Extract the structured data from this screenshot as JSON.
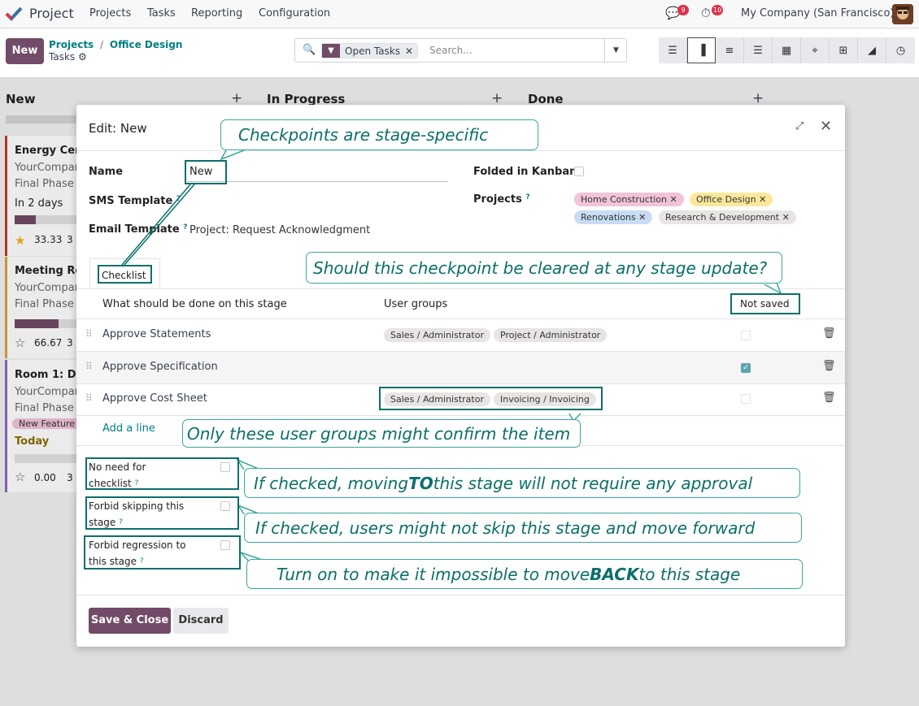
{
  "nav": {
    "app": "Project",
    "menus": [
      "Projects",
      "Tasks",
      "Reporting",
      "Configuration"
    ],
    "chat_count": "9",
    "activity_count": "10",
    "company": "My Company (San Francisco)"
  },
  "control": {
    "new_label": "New",
    "breadcrumb_root": "Projects",
    "breadcrumb_sep": "/",
    "breadcrumb_project": "Office Design",
    "breadcrumb_current": "Tasks",
    "facet": "Open Tasks",
    "search_placeholder": "Search..."
  },
  "kanban": {
    "columns": [
      "New",
      "In Progress",
      "Done"
    ],
    "cards": [
      {
        "title": "Energy Cer",
        "customer": "YourCompan",
        "stage": "Final Phase",
        "deadline": "In 2 days",
        "rating": "33.33",
        "count": "3",
        "progress": 0.33
      },
      {
        "title": "Meeting Ro",
        "customer": "YourCompan",
        "stage": "Final Phase",
        "rating": "66.67",
        "count": "3",
        "progress": 0.67
      },
      {
        "title": "Room 1: De",
        "customer": "YourCompan",
        "stage": "Final Phase",
        "tag": "New Feature",
        "deadline": "Today",
        "rating": "0.00",
        "count": "3",
        "progress": 0
      }
    ]
  },
  "modal": {
    "title": "Edit: New",
    "name_label": "Name",
    "name_value": "New",
    "sms_label": "SMS Template",
    "email_label": "Email Template",
    "email_value": "Project: Request Acknowledgment",
    "folded_label": "Folded in Kanban",
    "projects_label": "Projects",
    "projects": [
      {
        "name": "Home Construction",
        "color": "#f2c3d9"
      },
      {
        "name": "Office Design",
        "color": "#fbe89c"
      },
      {
        "name": "Renovations",
        "color": "#c8dcf5"
      },
      {
        "name": "Research & Development",
        "color": "#e9e4e4"
      }
    ],
    "tab": "Checklist",
    "col_task": "What should be done on this stage",
    "col_groups": "User groups",
    "col_saved": "Not saved",
    "rows": [
      {
        "task": "Approve Statements",
        "groups": [
          "Sales / Administrator",
          "Project / Administrator"
        ],
        "checked": false
      },
      {
        "task": "Approve Specification",
        "groups": [],
        "checked": true
      },
      {
        "task": "Approve Cost Sheet",
        "groups": [
          "Sales / Administrator",
          "Invoicing / Invoicing"
        ],
        "checked": false
      }
    ],
    "add_line": "Add a line",
    "no_need_1": "No need for",
    "no_need_2": "checklist",
    "forbid_skip_1": "Forbid skipping this",
    "forbid_skip_2": "stage",
    "forbid_reg_1": "Forbid regression to",
    "forbid_reg_2": "this stage",
    "save": "Save & Close",
    "discard": "Discard"
  },
  "callouts": {
    "stage_specific": "Checkpoints are stage-specific",
    "cleared": "Should this checkpoint be cleared at any stage update?",
    "groups": "Only these user groups might confirm the item",
    "no_need_a": "If checked, moving ",
    "no_need_b": "TO",
    "no_need_c": " this stage will not require any approval",
    "skip": "If checked, users might not skip this stage and move forward",
    "back_a": "Turn on to make it impossible to move ",
    "back_b": "BACK",
    "back_c": " to this stage"
  },
  "colors": {
    "accent": "#714b67",
    "link": "#017e84",
    "callout": "#0b6f6a"
  }
}
